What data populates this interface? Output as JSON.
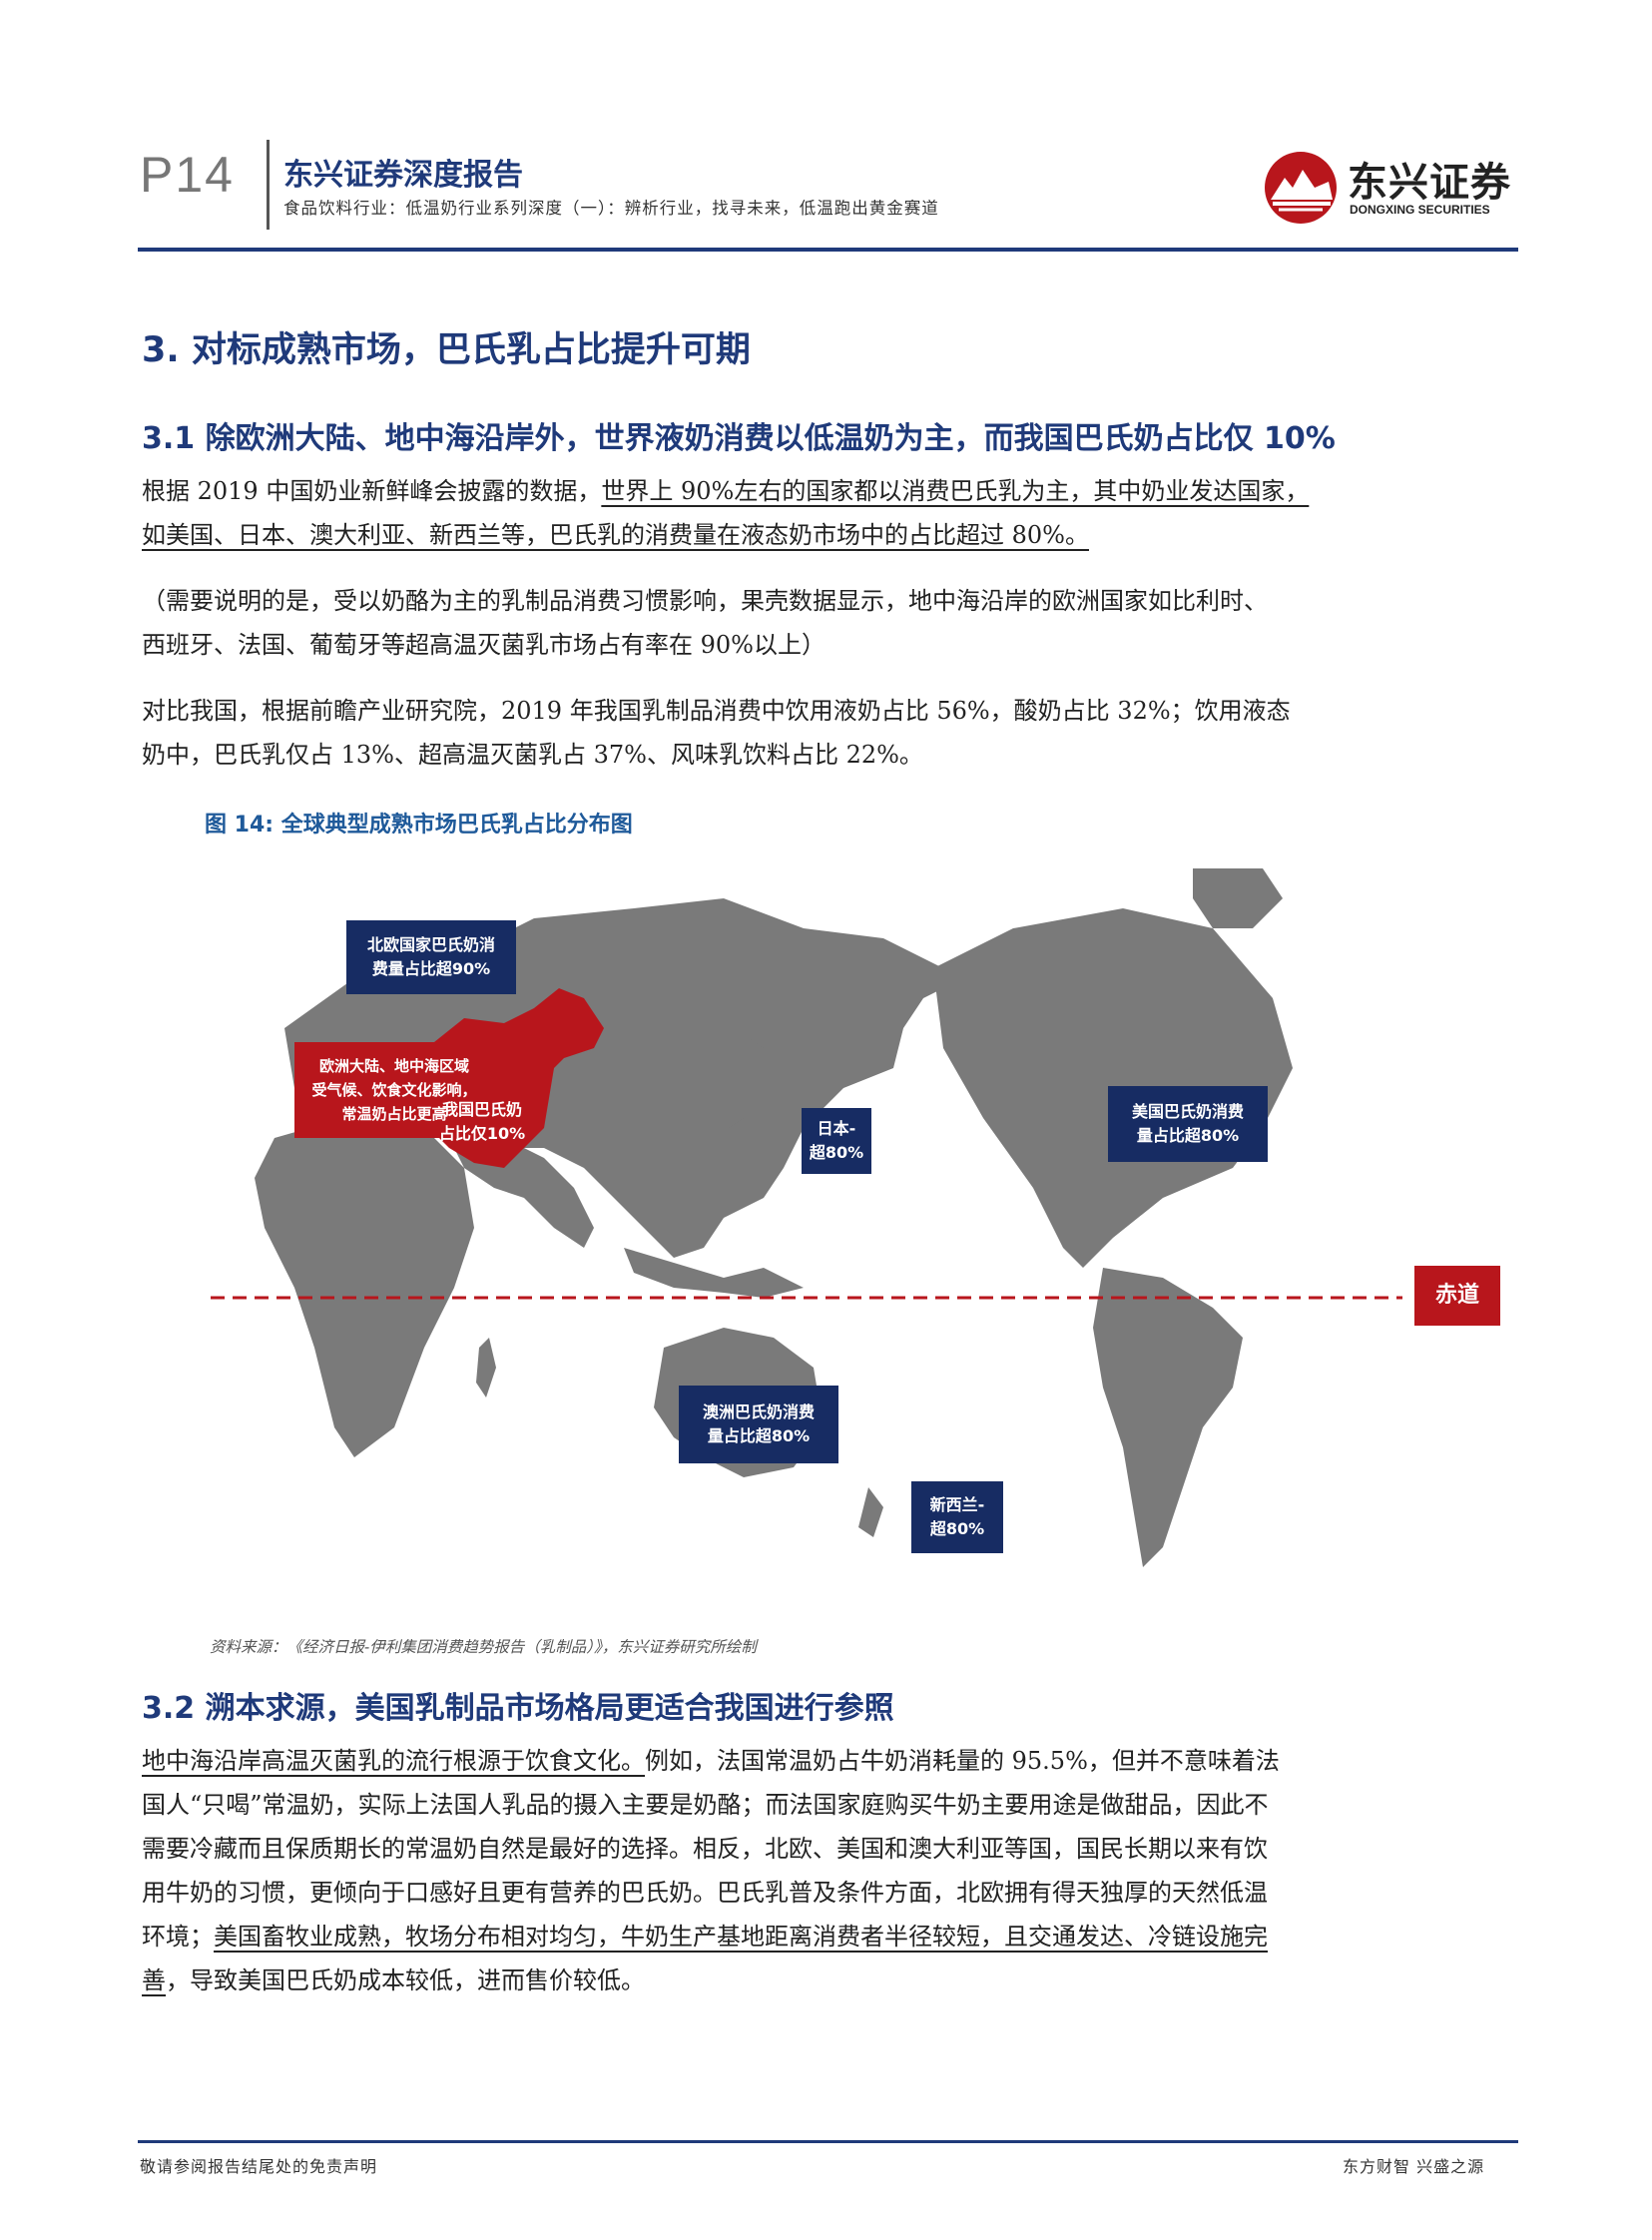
{
  "header": {
    "page_number": "P14",
    "report_title": "东兴证券深度报告",
    "subtitle": "食品饮料行业：低温奶行业系列深度（一）：辨析行业，找寻未来，低温跑出黄金赛道",
    "logo_name": "东兴证券",
    "logo_en": "DONGXING SECURITIES"
  },
  "section3": {
    "title": "3. 对标成熟市场，巴氏乳占比提升可期"
  },
  "section31": {
    "title": "3.1 除欧洲大陆、地中海沿岸外，世界液奶消费以低温奶为主，而我国巴氏奶占比仅 10%",
    "p1": {
      "l1_a": "根据 2019 中国奶业新鲜峰会披露的数据，",
      "l1_b": "世界上 90%左右的国家都以消费巴氏乳为主，其中奶业发达国家，",
      "l2": "如美国、日本、澳大利亚、新西兰等，巴氏乳的消费量在液态奶市场中的占比超过 80%。"
    },
    "p2": {
      "l1": "（需要说明的是，受以奶酪为主的乳制品消费习惯影响，果壳数据显示，地中海沿岸的欧洲国家如比利时、",
      "l2": "西班牙、法国、葡萄牙等超高温灭菌乳市场占有率在 90%以上）"
    },
    "p3": {
      "l1": "对比我国，根据前瞻产业研究院，2019 年我国乳制品消费中饮用液奶占比 56%，酸奶占比 32%；饮用液态",
      "l2": "奶中，巴氏乳仅占 13%、超高温灭菌乳占 37%、风味乳饮料占比 22%。"
    }
  },
  "figure": {
    "title": "图 14: 全球典型成熟市场巴氏乳占比分布图",
    "labels": {
      "north_europe": [
        "北欧国家巴氏奶消",
        "费量占比超90%"
      ],
      "europe_med": [
        "欧洲大陆、地中海区域",
        "受气候、饮食文化影响，",
        "常温奶占比更高"
      ],
      "china": [
        "我国巴氏奶",
        "占比仅10%"
      ],
      "japan": [
        "日本-",
        "超80%"
      ],
      "usa": [
        "美国巴氏奶消费",
        "量占比超80%"
      ],
      "equator": "赤道",
      "australia": [
        "澳洲巴氏奶消费",
        "量占比超80%"
      ],
      "new_zealand": [
        "新西兰-",
        "超80%"
      ]
    },
    "colors": {
      "land": "#7a7a7a",
      "china": "#b8161c",
      "navy": "#172c63",
      "red": "#b8161c"
    },
    "source": "资料来源：《经济日报-伊利集团消费趋势报告（乳制品）》，东兴证券研究所绘制"
  },
  "section32": {
    "title": "3.2 溯本求源，美国乳制品市场格局更适合我国进行参照",
    "p1": {
      "l1_a": "地中海沿岸高温灭菌乳的流行根源于饮食文化。",
      "l1_b": "例如，法国常温奶占牛奶消耗量的 95.5%，但并不意味着法",
      "l2": "国人“只喝”常温奶，实际上法国人乳品的摄入主要是奶酪；而法国家庭购买牛奶主要用途是做甜品，因此不",
      "l3": "需要冷藏而且保质期长的常温奶自然是最好的选择。相反，北欧、美国和澳大利亚等国，国民长期以来有饮",
      "l4": "用牛奶的习惯，更倾向于口感好且更有营养的巴氏奶。巴氏乳普及条件方面，北欧拥有得天独厚的天然低温",
      "l5_a": "环境；",
      "l5_b": "美国畜牧业成熟，牧场分布相对均匀，牛奶生产基地距离消费者半径较短，且交通发达、冷链设施完",
      "l6_a": "善",
      "l6_b": "，导致美国巴氏奶成本较低，进而售价较低。"
    }
  },
  "footer": {
    "left": "敬请参阅报告结尾处的免责声明",
    "right": "东方财智 兴盛之源"
  }
}
